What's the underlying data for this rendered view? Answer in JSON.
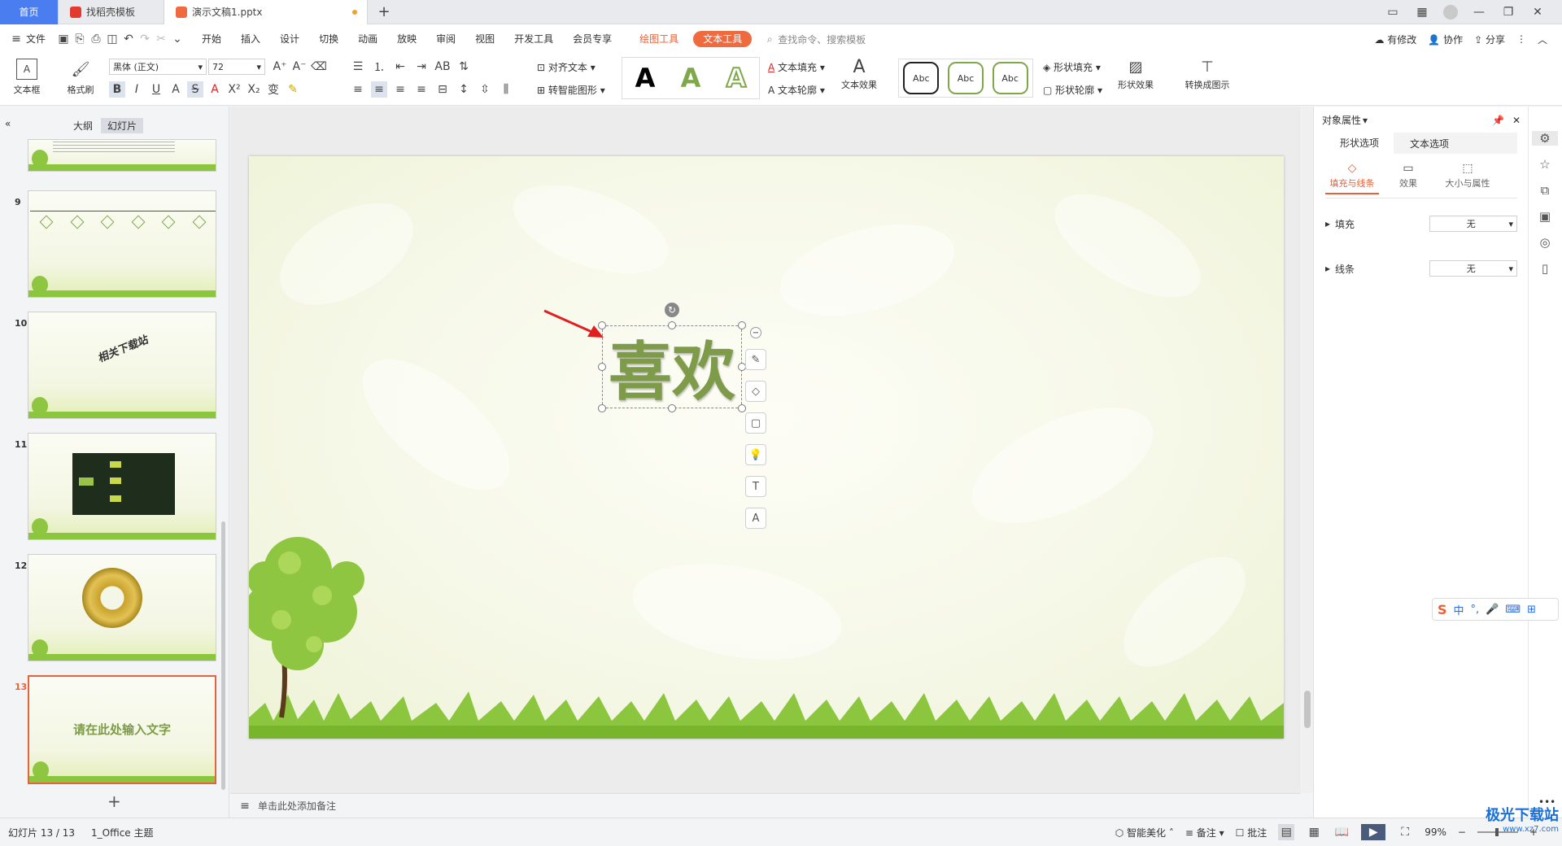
{
  "titlebar": {
    "tabs": [
      {
        "label": "首页"
      },
      {
        "label": "找稻壳模板"
      },
      {
        "label": "演示文稿1.pptx"
      }
    ]
  },
  "menubar": {
    "file": "文件",
    "items": [
      "开始",
      "插入",
      "设计",
      "切换",
      "动画",
      "放映",
      "审阅",
      "视图",
      "开发工具",
      "会员专享"
    ],
    "draw_tools": "绘图工具",
    "text_tools": "文本工具",
    "search_placeholder": "查找命令、搜索模板",
    "modified": "有修改",
    "collab": "协作",
    "share": "分享"
  },
  "ribbon": {
    "textbox": "文本框",
    "format_painter": "格式刷",
    "font_name": "黑体 (正文)",
    "font_size": "72",
    "align_text": "对齐文本",
    "smart_shape": "转智能图形",
    "text_fill": "文本填充",
    "text_outline": "文本轮廓",
    "text_effect": "文本效果",
    "abc": "Abc",
    "shape_fill": "形状填充",
    "shape_outline": "形状轮廓",
    "shape_effect": "形状效果",
    "convert": "转换成图示"
  },
  "leftpanel": {
    "tab_outline": "大纲",
    "tab_slides": "幻灯片",
    "slides": [
      {
        "num": "9"
      },
      {
        "num": "10",
        "text": "相关下载站"
      },
      {
        "num": "11"
      },
      {
        "num": "12"
      },
      {
        "num": "13",
        "text": "请在此处输入文字"
      }
    ]
  },
  "slide": {
    "main_text": "喜欢"
  },
  "notes": {
    "placeholder": "单击此处添加备注"
  },
  "rightpanel": {
    "title": "对象属性",
    "tab_shape": "形状选项",
    "tab_text": "文本选项",
    "sub_fill": "填充与线条",
    "sub_effect": "效果",
    "sub_size": "大小与属性",
    "fill_label": "填充",
    "fill_value": "无",
    "line_label": "线条",
    "line_value": "无"
  },
  "statusbar": {
    "slide_count": "幻灯片 13 / 13",
    "theme": "1_Office 主题",
    "beautify": "智能美化",
    "notes": "备注",
    "comment": "批注",
    "zoom": "99%"
  },
  "ime": {
    "lang": "中"
  },
  "watermark": {
    "site": "极光下载站",
    "url": "www.xz7.com"
  },
  "colors": {
    "accent": "#ef6a3f",
    "home_tab": "#4a7ef0",
    "slide_text": "#7e9b4a",
    "arrow": "#e02020"
  }
}
